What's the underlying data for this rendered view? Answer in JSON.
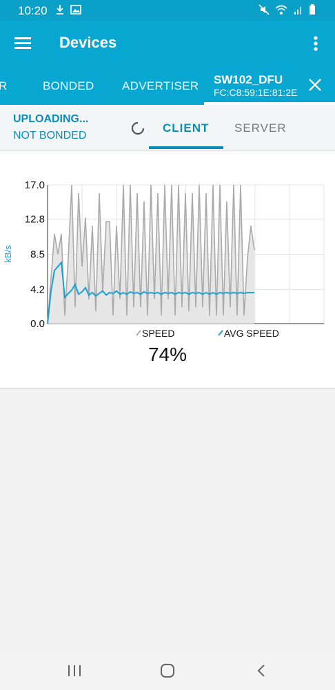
{
  "status_bar": {
    "time": "10:20",
    "icons_left": [
      "download-icon",
      "image-icon"
    ],
    "icons_right": [
      "mute-icon",
      "wifi-icon",
      "signal-icon",
      "battery-icon"
    ]
  },
  "app_bar": {
    "title": "Devices",
    "menu_icon": "hamburger-menu-icon",
    "more_icon": "more-vert-icon"
  },
  "tabs": {
    "items": [
      {
        "label": "R"
      },
      {
        "label": "BONDED"
      },
      {
        "label": "ADVERTISER"
      }
    ],
    "active": {
      "name": "SW102_DFU",
      "mac": "FC:C8:59:1E:81:2E",
      "close_icon": "close-icon"
    }
  },
  "subbar": {
    "status_line1": "UPLOADING...",
    "status_line2": "NOT BONDED",
    "client_label": "CLIENT",
    "server_label": "SERVER",
    "spinner_icon": "progress-spinner-icon"
  },
  "chart_data": {
    "type": "area",
    "ylabel": "kB/s",
    "xlabel": "",
    "ylim": [
      0,
      17.0
    ],
    "y_ticks": [
      "17.0",
      "12.8",
      "8.5",
      "4.2",
      "0.0"
    ],
    "grid": true,
    "legend_placement": "bottom",
    "series": [
      {
        "name": "SPEED",
        "color": "#aaaaaa",
        "values": [
          0,
          5.5,
          11,
          8.5,
          11,
          1,
          8,
          17,
          2,
          16,
          7,
          13,
          3,
          12,
          1.5,
          16,
          4,
          12.5,
          12.5,
          1,
          12,
          3,
          17,
          1,
          17,
          2,
          16,
          2,
          15,
          1,
          17,
          3,
          16,
          1,
          17,
          3,
          17,
          1,
          17,
          2,
          16,
          1.5,
          16,
          2,
          17,
          2,
          16,
          1,
          17,
          1,
          17,
          1,
          15,
          2,
          17,
          1,
          17,
          1,
          8,
          12,
          9
        ]
      },
      {
        "name": "AVG SPEED",
        "color": "#1aa0d3",
        "values": [
          0,
          4,
          6.5,
          7,
          7.5,
          3.2,
          3.7,
          4.1,
          4.8,
          3.6,
          3.9,
          4.4,
          3.5,
          3.8,
          3.4,
          3.7,
          4.0,
          3.5,
          3.8,
          3.7,
          4.0,
          3.6,
          3.8,
          3.6,
          3.9,
          3.7,
          3.8,
          3.6,
          3.9,
          3.7,
          3.8,
          3.7,
          3.8,
          3.6,
          3.8,
          3.7,
          3.8,
          3.6,
          3.8,
          3.7,
          3.8,
          3.6,
          3.8,
          3.7,
          3.8,
          3.6,
          3.8,
          3.6,
          3.8,
          3.6,
          3.8,
          3.7,
          3.8,
          3.7,
          3.8,
          3.7,
          3.8,
          3.7,
          3.8,
          3.8,
          3.8
        ]
      }
    ]
  },
  "progress": {
    "percent_label": "74%",
    "value": 74
  },
  "nav_bar": {
    "icons": [
      "recent-apps-icon",
      "home-icon",
      "back-icon"
    ]
  },
  "colors": {
    "primary": "#08a7d2",
    "accent": "#0b8db5",
    "speed": "#aaaaaa",
    "avg_speed": "#1aa0d3"
  }
}
